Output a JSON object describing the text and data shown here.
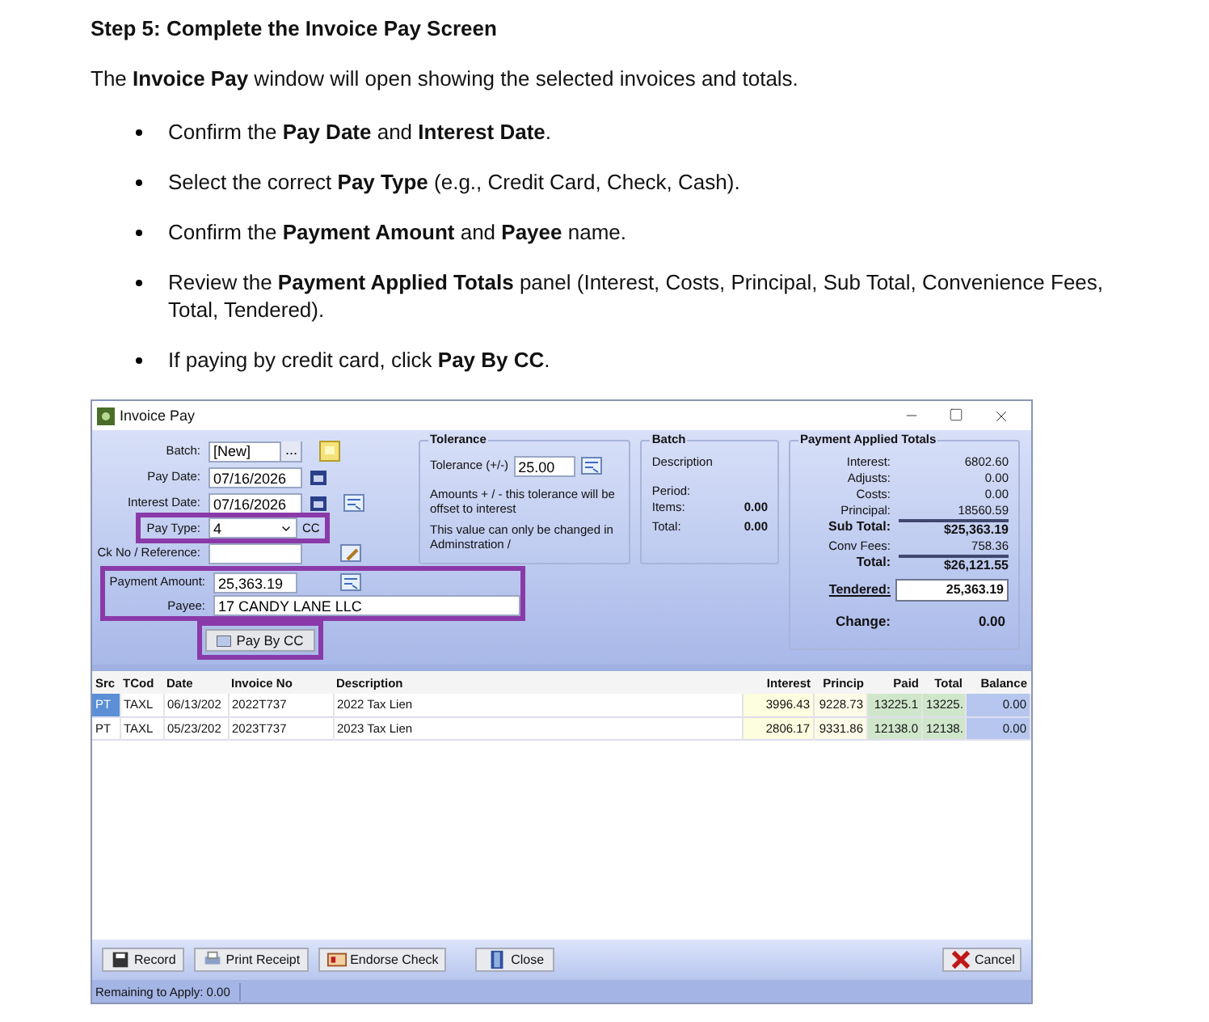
{
  "heading": "Step 5: Complete the Invoice Pay Screen",
  "intro": "The **Invoice Pay** window will open showing the selected invoices and totals.",
  "bullets": [
    "Confirm the **Pay Date** and **Interest Date**.",
    "Select the correct **Pay Type** (e.g., Credit Card, Check, Cash).",
    "Confirm the **Payment Amount** and **Payee** name.",
    "Review the **Payment Applied Totals** panel (Interest, Costs, Principal, Sub Total, Convenience Fees, Total, Tendered).",
    "If paying by credit card, click **Pay By CC**."
  ],
  "window": {
    "title": "Invoice Pay",
    "form": {
      "batch_label": "Batch:",
      "batch": "[New]",
      "browse": "...",
      "pay_date_label": "Pay Date:",
      "pay_date": "07/16/2026",
      "interest_date_label": "Interest Date:",
      "interest_date": "07/16/2026",
      "pay_type_label": "Pay Type:",
      "pay_type": "4",
      "pay_type_code": "CC",
      "ck_label": "Ck No / Reference:",
      "payment_amount_label": "Payment Amount:",
      "payment_amount": "25,363.19",
      "payee_label": "Payee:",
      "payee": "17 CANDY LANE LLC",
      "pay_by_cc": "Pay By CC"
    },
    "tolerance": {
      "title": "Tolerance",
      "label": "Tolerance (+/-)",
      "value": "25.00",
      "note1": "Amounts + / - this tolerance will be offset to interest",
      "note2": "This value can only be changed in Adminstration /"
    },
    "batch": {
      "title": "Batch",
      "description": "Description",
      "period": "Period:",
      "items_label": "Items:",
      "items": "0.00",
      "total_label": "Total:",
      "total": "0.00"
    },
    "totals": {
      "title": "Payment Applied Totals",
      "lines": [
        {
          "label": "Interest:",
          "value": "6802.60",
          "kind": "plain"
        },
        {
          "label": "Adjusts:",
          "value": "0.00",
          "kind": "plain"
        },
        {
          "label": "Costs:",
          "value": "0.00",
          "kind": "plain"
        },
        {
          "label": "Principal:",
          "value": "18560.59",
          "kind": "plain"
        },
        {
          "label": "Sub Total:",
          "value": "$25,363.19",
          "kind": "sum"
        },
        {
          "label": "Conv Fees:",
          "value": "758.36",
          "kind": "plain"
        },
        {
          "label": "Total:",
          "value": "$26,121.55",
          "kind": "sum"
        }
      ],
      "tendered_label": "Tendered:",
      "tendered": "25,363.19",
      "change_label": "Change:",
      "change": "0.00"
    },
    "table": {
      "columns": [
        "Src",
        "TCod",
        "Date",
        "Invoice No",
        "Description",
        "Interest",
        "Princip",
        "Paid",
        "Total",
        "Balance"
      ],
      "rows": [
        {
          "selected": true,
          "cells": [
            "PT",
            "TAXL",
            "06/13/202",
            "2022T737",
            "2022 Tax Lien",
            "3996.43",
            "9228.73",
            "13225.1",
            "13225.",
            "0.00"
          ]
        },
        {
          "selected": false,
          "cells": [
            "PT",
            "TAXL",
            "05/23/202",
            "2023T737",
            "2023 Tax Lien",
            "2806.17",
            "9331.86",
            "12138.0",
            "12138.",
            "0.00"
          ]
        }
      ]
    },
    "buttons": [
      {
        "label": "Record",
        "kind": "record"
      },
      {
        "label": "Print Receipt",
        "kind": "print"
      },
      {
        "label": "Endorse Check",
        "kind": "endorse"
      },
      {
        "label": "Close",
        "kind": "close"
      },
      {
        "label": "Cancel",
        "kind": "cancel"
      }
    ],
    "status": "Remaining to Apply: 0.00"
  }
}
